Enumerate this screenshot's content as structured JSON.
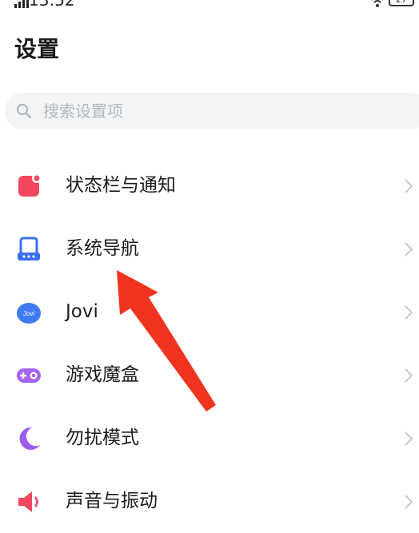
{
  "status_bar": {
    "time": "13:52",
    "battery": "27"
  },
  "header": {
    "title": "设置"
  },
  "search": {
    "placeholder": "搜索设置项"
  },
  "settings": {
    "items": [
      {
        "label": "状态栏与通知",
        "icon": "notification-icon",
        "color": "#f2485f"
      },
      {
        "label": "系统导航",
        "icon": "navigation-icon",
        "color": "#3b6ef5"
      },
      {
        "label": "Jovi",
        "icon": "jovi-icon",
        "color": "#3f7bf2"
      },
      {
        "label": "游戏魔盒",
        "icon": "game-box-icon",
        "color": "#a463f0"
      },
      {
        "label": "勿扰模式",
        "icon": "moon-icon",
        "color": "#9b5cf0"
      },
      {
        "label": "声音与振动",
        "icon": "sound-icon",
        "color": "#f2485f"
      }
    ]
  },
  "colors": {
    "annotation_arrow": "#f0341f",
    "search_background": "#f3f4f6",
    "chevron": "#c8c8c8"
  }
}
